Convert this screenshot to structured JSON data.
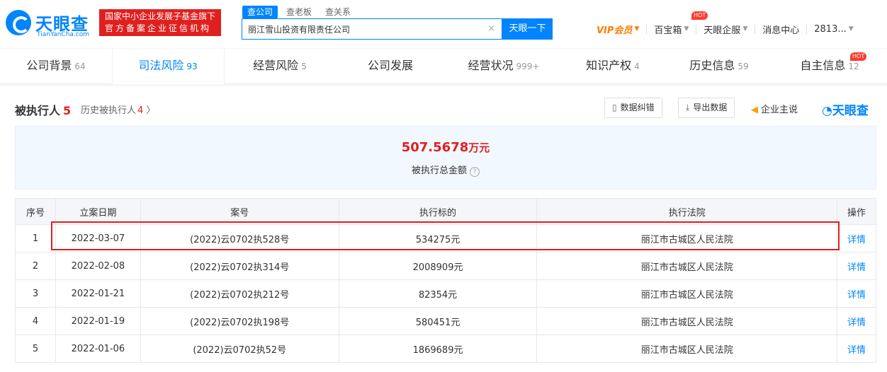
{
  "header": {
    "logo": {
      "name": "天眼查",
      "domain": "TianYanCha.com"
    },
    "gov_badge": {
      "line1": "国家中小企业发展子基金旗下",
      "line2": "官方备案企业征信机构"
    },
    "search": {
      "tabs": [
        "查公司",
        "查老板",
        "查关系"
      ],
      "value": "丽江雪山投资有限责任公司",
      "button": "天眼一下"
    },
    "nav": {
      "vip": "VIP会员",
      "treasure": "百宝箱",
      "hot": "HOT",
      "enterprise": "天眼企服",
      "messages": "消息中心",
      "account": "2813..."
    }
  },
  "tabs": [
    {
      "label": "公司背景",
      "count": "64"
    },
    {
      "label": "司法风险",
      "count": "93"
    },
    {
      "label": "经营风险",
      "count": "5"
    },
    {
      "label": "公司发展",
      "count": ""
    },
    {
      "label": "经营状况",
      "count": "999+"
    },
    {
      "label": "知识产权",
      "count": "4"
    },
    {
      "label": "历史信息",
      "count": "59"
    },
    {
      "label": "自主信息",
      "count": "12"
    }
  ],
  "tab_hot": "HOT",
  "section": {
    "title": "被执行人",
    "count": "5",
    "history_label": "历史被执行人",
    "history_count": "4",
    "buttons": {
      "correct": "数据纠错",
      "export": "导出数据",
      "enterprise": "企业主说"
    },
    "brand": "天眼查"
  },
  "summary": {
    "amount": "507.5678",
    "unit": "万元",
    "label": "被执行总金额"
  },
  "table": {
    "headers": [
      "序号",
      "立案日期",
      "案号",
      "执行标的",
      "执行法院",
      "操作"
    ],
    "rows": [
      {
        "no": "1",
        "date": "2022-03-07",
        "case": "(2022)云0702执528号",
        "amount": "534275元",
        "court": "丽江市古城区人民法院",
        "action": "详情"
      },
      {
        "no": "2",
        "date": "2022-02-08",
        "case": "(2022)云0702执314号",
        "amount": "2008909元",
        "court": "丽江市古城区人民法院",
        "action": "详情"
      },
      {
        "no": "3",
        "date": "2022-01-21",
        "case": "(2022)云0702执212号",
        "amount": "82354元",
        "court": "丽江市古城区人民法院",
        "action": "详情"
      },
      {
        "no": "4",
        "date": "2022-01-19",
        "case": "(2022)云0702执198号",
        "amount": "580451元",
        "court": "丽江市古城区人民法院",
        "action": "详情"
      },
      {
        "no": "5",
        "date": "2022-01-06",
        "case": "(2022)云0702执52号",
        "amount": "1869689元",
        "court": "丽江市古城区人民法院",
        "action": "详情"
      }
    ]
  },
  "colors": {
    "brand": "#0084ff",
    "accent": "#e0201f",
    "vip": "#ff7d00"
  },
  "icons": [
    "search-clear-icon",
    "caret-down-icon",
    "chevron-right-icon",
    "document-icon",
    "download-icon",
    "megaphone-icon",
    "help-icon"
  ]
}
